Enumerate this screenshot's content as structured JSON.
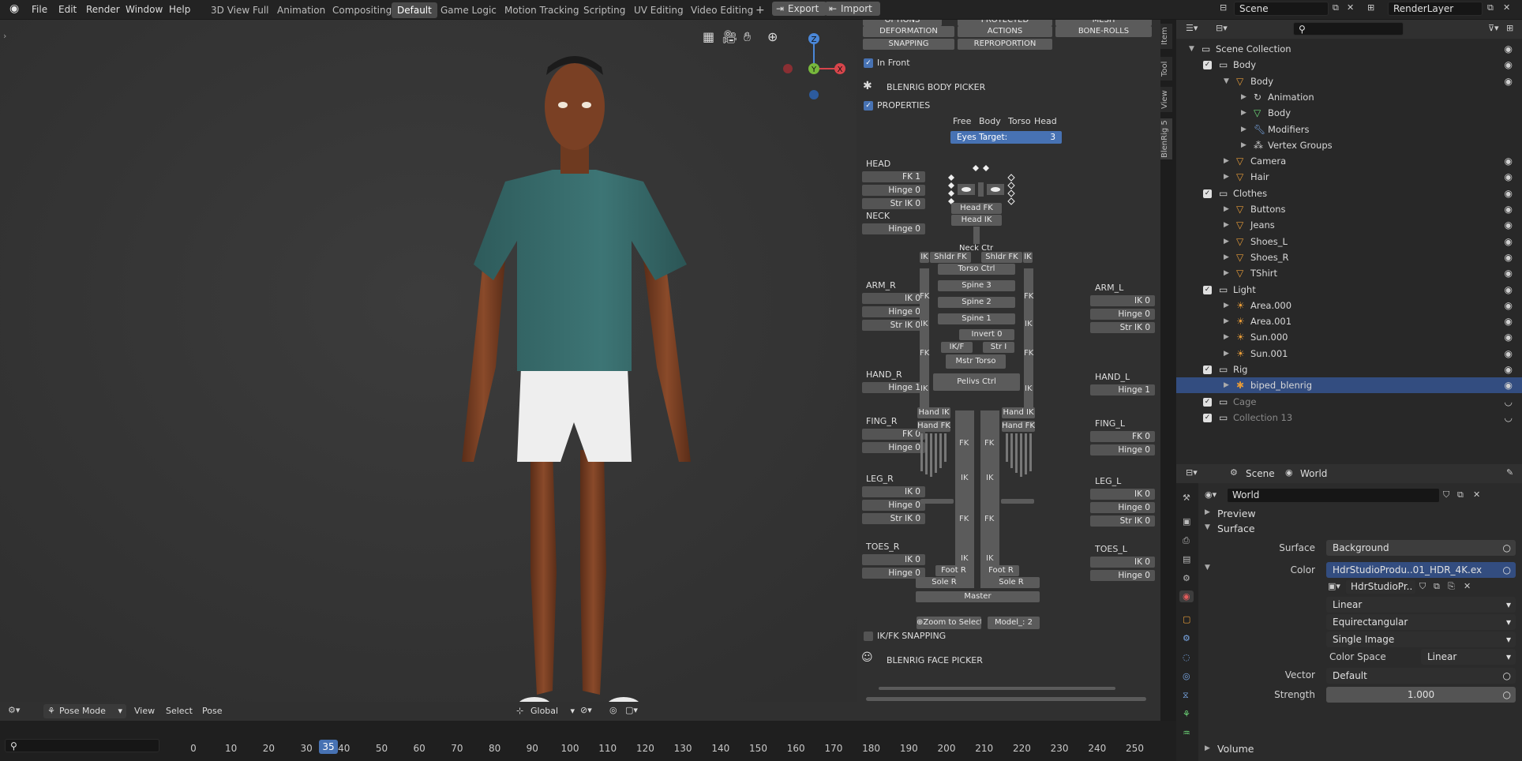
{
  "topbar": {
    "menus": [
      "File",
      "Edit",
      "Render",
      "Window",
      "Help"
    ],
    "workspaces": [
      "3D View Full",
      "Animation",
      "Compositing",
      "Default",
      "Game Logic",
      "Motion Tracking",
      "Scripting",
      "UV Editing",
      "Video Editing"
    ],
    "active_workspace": "Default",
    "add_tab": "+",
    "export_label": "Export",
    "import_label": "Import",
    "scene": "Scene",
    "render_layer": "RenderLayer"
  },
  "viewport": {
    "gizmo": {
      "z": "Z",
      "y": "Y",
      "x": "X"
    },
    "mode": "Pose Mode",
    "menus": [
      "View",
      "Select",
      "Pose"
    ],
    "transform_orientation": "Global"
  },
  "picker": {
    "top_buttons": [
      "OPTIONS",
      "PROTECTED",
      "MESH",
      "DEFORMATION",
      "ACTIONS",
      "BONE-ROLLS",
      "SNAPPING",
      "REPROPORTION"
    ],
    "in_front": "In Front",
    "body_picker": "BLENRIG BODY PICKER",
    "properties": "PROPERTIES",
    "modes": [
      "Free",
      "Body",
      "Torso",
      "Head"
    ],
    "eyes_target_label": "Eyes Target:",
    "eyes_target_value": "3",
    "head": {
      "title": "HEAD",
      "values": [
        "FK 1",
        "Hinge 0",
        "Str IK 0"
      ]
    },
    "neck": {
      "title": "NECK",
      "values": [
        "Hinge 0"
      ]
    },
    "arm_r": {
      "title": "ARM_R",
      "values": [
        "IK 0",
        "Hinge 0",
        "Str IK 0"
      ]
    },
    "arm_l": {
      "title": "ARM_L",
      "values": [
        "IK 0",
        "Hinge 0",
        "Str IK 0"
      ]
    },
    "hand_r": {
      "title": "HAND_R",
      "values": [
        "Hinge 1"
      ]
    },
    "hand_l": {
      "title": "HAND_L",
      "values": [
        "Hinge 1"
      ]
    },
    "fing_r": {
      "title": "FING_R",
      "values": [
        "FK 0",
        "Hinge 0"
      ]
    },
    "fing_l": {
      "title": "FING_L",
      "values": [
        "FK 0",
        "Hinge 0"
      ]
    },
    "leg_r": {
      "title": "LEG_R",
      "values": [
        "IK 0",
        "Hinge 0",
        "Str IK 0"
      ]
    },
    "leg_l": {
      "title": "LEG_L",
      "values": [
        "IK 0",
        "Hinge 0",
        "Str IK 0"
      ]
    },
    "toes_r": {
      "title": "TOES_R",
      "values": [
        "IK 0",
        "Hinge 0"
      ]
    },
    "toes_l": {
      "title": "TOES_L",
      "values": [
        "IK 0",
        "Hinge 0"
      ]
    },
    "rig": {
      "head_fk": "Head FK",
      "head_ik": "Head IK",
      "neck_ctrl": "Neck Ctrl",
      "shldr_fk_r": "Shldr FK",
      "shldr_fk_l": "Shldr FK",
      "torso_ctrl": "Torso Ctrl",
      "spine3": "Spine 3",
      "spine2": "Spine 2",
      "spine1": "Spine 1",
      "invert": "Invert 0",
      "ikf": "IK/F",
      "str_i": "Str I",
      "mstr_torso": "Mstr Torso",
      "pelvis": "Pelivs Ctrl",
      "hand_ik_r": "Hand IK",
      "hand_fk_r": "Hand FK",
      "hand_ik_l": "Hand IK",
      "hand_fk_l": "Hand FK",
      "foot_r": "Foot R",
      "foot_l": "Foot R",
      "sole_r": "Sole R",
      "sole_l": "Sole R",
      "master": "Master",
      "ik": "IK",
      "fk": "FK"
    },
    "zoom": "Zoom to Select..",
    "model_label": "Model_:",
    "model_value": "2",
    "ikfk_snapping": "IK/FK SNAPPING",
    "face_picker": "BLENRIG FACE PICKER",
    "side_tabs": [
      "Item",
      "Tool",
      "View",
      "BlenRig 5"
    ]
  },
  "outliner": {
    "search_placeholder": "",
    "rows": [
      {
        "name": "Scene Collection",
        "indent": 0,
        "type": "collection"
      },
      {
        "name": "Body",
        "indent": 1,
        "type": "collection"
      },
      {
        "name": "Body",
        "indent": 2,
        "type": "object"
      },
      {
        "name": "Animation",
        "indent": 3,
        "type": "anim"
      },
      {
        "name": "Body",
        "indent": 3,
        "type": "mesh"
      },
      {
        "name": "Modifiers",
        "indent": 3,
        "type": "modifier"
      },
      {
        "name": "Vertex Groups",
        "indent": 3,
        "type": "vgroup"
      },
      {
        "name": "Camera",
        "indent": 2,
        "type": "object"
      },
      {
        "name": "Hair",
        "indent": 2,
        "type": "object"
      },
      {
        "name": "Clothes",
        "indent": 1,
        "type": "collection"
      },
      {
        "name": "Buttons",
        "indent": 2,
        "type": "object"
      },
      {
        "name": "Jeans",
        "indent": 2,
        "type": "object"
      },
      {
        "name": "Shoes_L",
        "indent": 2,
        "type": "object"
      },
      {
        "name": "Shoes_R",
        "indent": 2,
        "type": "object"
      },
      {
        "name": "TShirt",
        "indent": 2,
        "type": "object"
      },
      {
        "name": "Light",
        "indent": 1,
        "type": "collection"
      },
      {
        "name": "Area.000",
        "indent": 2,
        "type": "light"
      },
      {
        "name": "Area.001",
        "indent": 2,
        "type": "light"
      },
      {
        "name": "Sun.000",
        "indent": 2,
        "type": "light"
      },
      {
        "name": "Sun.001",
        "indent": 2,
        "type": "light"
      },
      {
        "name": "Rig",
        "indent": 1,
        "type": "collection"
      },
      {
        "name": "biped_blenrig",
        "indent": 2,
        "type": "armature",
        "selected": true
      },
      {
        "name": "Cage",
        "indent": 1,
        "type": "collection",
        "dim": true
      },
      {
        "name": "Collection 13",
        "indent": 1,
        "type": "collection",
        "dim": true
      }
    ]
  },
  "properties": {
    "scene": "Scene",
    "world": "World",
    "world_name": "World",
    "preview": "Preview",
    "surface": "Surface",
    "surface_label": "Surface",
    "surface_value": "Background",
    "color_label": "Color",
    "color_value": "HdrStudioProdu..01_HDR_4K.ex",
    "image_name": "HdrStudioPr..",
    "interpolation": "Linear",
    "projection": "Equirectangular",
    "source": "Single Image",
    "color_space_label": "Color Space",
    "color_space_value": "Linear",
    "vector_label": "Vector",
    "vector_value": "Default",
    "strength_label": "Strength",
    "strength_value": "1.000",
    "volume": "Volume"
  },
  "timeline": {
    "current_frame": "35",
    "ticks": [
      "0",
      "10",
      "20",
      "30",
      "40",
      "50",
      "60",
      "70",
      "80",
      "90",
      "100",
      "110",
      "120",
      "130",
      "140",
      "150",
      "160",
      "170",
      "180",
      "190",
      "200",
      "210",
      "220",
      "230",
      "240",
      "250"
    ]
  },
  "colors": {
    "accent": "#4772b3",
    "selected_row": "#334d80",
    "header": "#232323"
  }
}
